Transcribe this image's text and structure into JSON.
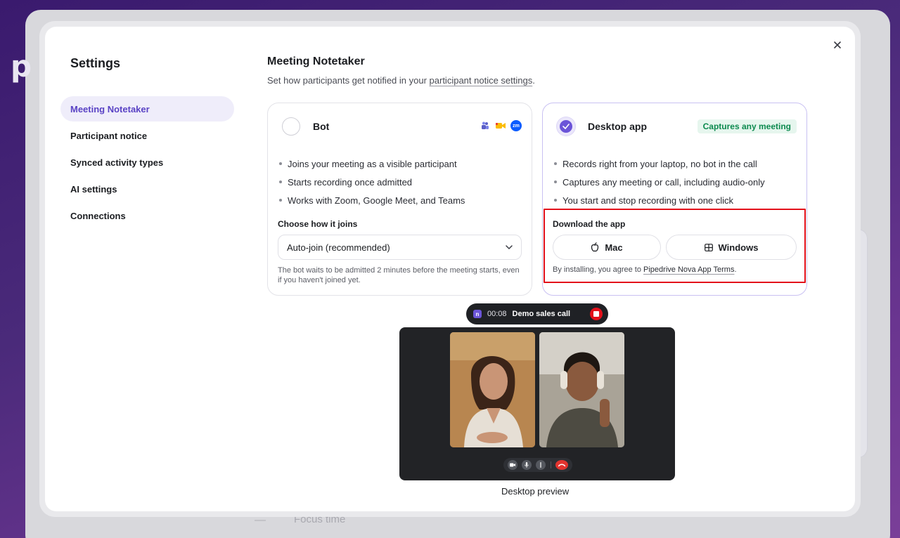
{
  "brand": {
    "logo_letter": "p"
  },
  "background": {
    "focus_time": "Focus time"
  },
  "settings": {
    "title": "Settings",
    "close_icon": "close-icon",
    "nav": [
      {
        "label": "Meeting Notetaker",
        "active": true
      },
      {
        "label": "Participant notice",
        "active": false
      },
      {
        "label": "Synced activity types",
        "active": false
      },
      {
        "label": "AI settings",
        "active": false
      },
      {
        "label": "Connections",
        "active": false
      }
    ]
  },
  "main": {
    "title": "Meeting Notetaker",
    "subtitle_prefix": "Set how participants get notified in your ",
    "subtitle_link": "participant notice settings",
    "subtitle_suffix": "."
  },
  "bot_card": {
    "title": "Bot",
    "selected": false,
    "app_icons": [
      "teams-icon",
      "google-meet-icon",
      "zoom-icon"
    ],
    "zoom_abbr": "zm",
    "features": [
      "Joins your meeting as a visible participant",
      "Starts recording once admitted",
      "Works with Zoom, Google Meet, and Teams"
    ],
    "join_label": "Choose how it joins",
    "join_value": "Auto-join (recommended)",
    "help": "The bot waits to be admitted 2 minutes before the meeting starts, even if you haven't joined yet."
  },
  "desktop_card": {
    "title": "Desktop app",
    "selected": true,
    "badge": "Captures any meeting",
    "features": [
      "Records right from your laptop, no bot in the call",
      "Captures any meeting or call, including audio-only",
      "You start and stop recording with one click"
    ],
    "download_label": "Download the app",
    "mac_label": "Mac",
    "windows_label": "Windows",
    "terms_prefix": "By installing, you agree to ",
    "terms_link": "Pipedrive Nova App Terms",
    "terms_suffix": "."
  },
  "recording": {
    "logo_letter": "n",
    "time": "00:08",
    "title": "Demo sales call"
  },
  "preview": {
    "caption": "Desktop preview"
  },
  "colors": {
    "accent": "#6b54d8",
    "highlight": "#e3111b",
    "badge_text": "#0d8a4f"
  }
}
